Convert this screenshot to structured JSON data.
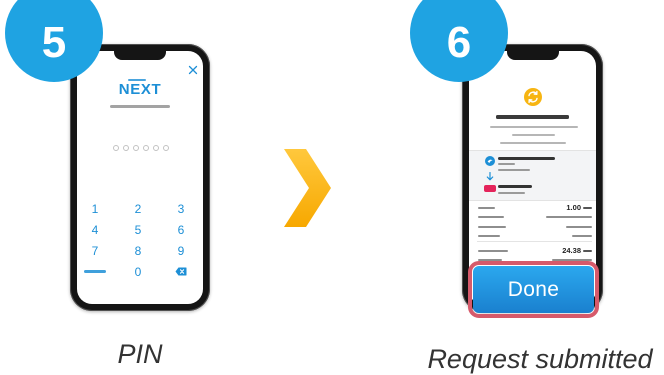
{
  "steps": [
    {
      "badge": "5",
      "caption": "PIN"
    },
    {
      "badge": "6",
      "caption": "Request submitted"
    }
  ],
  "pin_screen": {
    "logo": "NEXT",
    "keypad": [
      "1",
      "2",
      "3",
      "4",
      "5",
      "6",
      "7",
      "8",
      "9",
      "0"
    ]
  },
  "result_screen": {
    "detail_values": [
      "1.00",
      "24.38"
    ],
    "done_button": "Done"
  },
  "icons": {
    "close": "close-icon",
    "backspace": "backspace-icon",
    "status": "transfer-icon",
    "source_bank": "bank-icon",
    "direction": "arrow-down-icon",
    "recipient_bank": "recipient-bank-logo",
    "next_step": "chevron-right-icon"
  },
  "colors": {
    "badge": "#1fa3e2",
    "accent_blue": "#1d8fd6",
    "chevron": "#f7a800",
    "highlight": "#d65a6b",
    "status_icon": "#f7b512",
    "recipient_logo": "#e4245b"
  }
}
